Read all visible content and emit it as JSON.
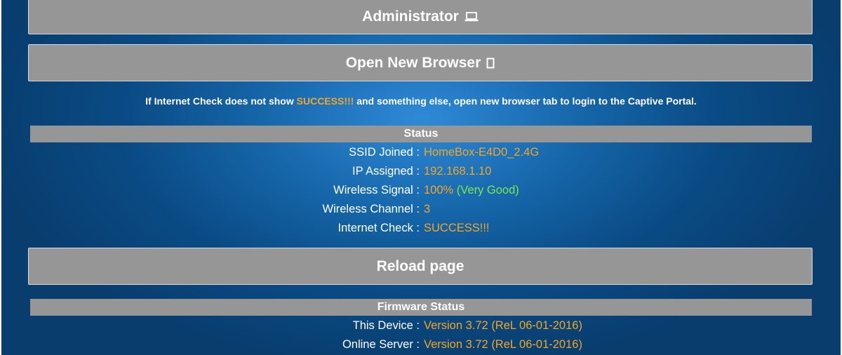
{
  "buttons": {
    "administrator": "Administrator",
    "open_new_browser": "Open New Browser",
    "reload_page": "Reload page"
  },
  "icons": {
    "administrator": "laptop-icon",
    "open_new_browser": "new-window-icon"
  },
  "notice": {
    "prefix": "If Internet Check does not show ",
    "highlight": "SUCCESS!!!",
    "suffix": " and something else, open new browser tab to login to the Captive Portal."
  },
  "status": {
    "title": "Status",
    "rows": [
      {
        "label": "SSID Joined :",
        "value": "HomeBox-E4D0_2.4G"
      },
      {
        "label": "IP Assigned :",
        "value": "192.168.1.10"
      },
      {
        "label": "Wireless Signal :",
        "value": "100%",
        "extra": "(Very Good)"
      },
      {
        "label": "Wireless Channel :",
        "value": "3"
      },
      {
        "label": "Internet Check :",
        "value": "SUCCESS!!!"
      }
    ]
  },
  "firmware": {
    "title": "Firmware Status",
    "rows": [
      {
        "label": "This Device :",
        "value": "Version 3.72 (ReL 06-01-2016)"
      },
      {
        "label": "Online Server :",
        "value": "Version 3.72 (ReL 06-01-2016)"
      }
    ]
  },
  "colors": {
    "accent": "#f5a623",
    "good": "#7ee84a",
    "bar": "#969696",
    "background": "#0a4b85"
  }
}
